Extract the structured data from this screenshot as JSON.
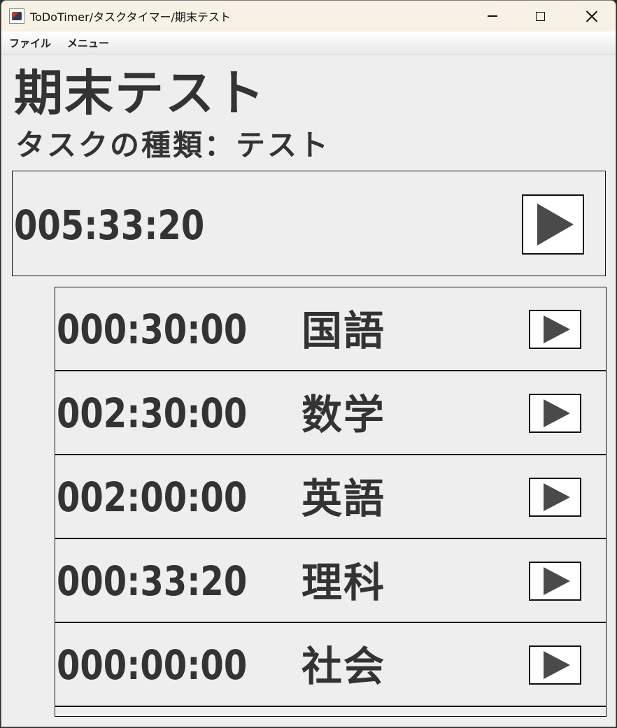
{
  "window": {
    "title": "ToDoTimer/タスクタイマー/期末テスト"
  },
  "menubar": {
    "items": [
      "ファイル",
      "メニュー"
    ]
  },
  "task": {
    "title": "期末テスト",
    "type_label": "タスクの種類：テスト",
    "total_time": "005:33:20"
  },
  "subtasks": [
    {
      "time": "000:30:00",
      "name": "国語"
    },
    {
      "time": "002:30:00",
      "name": "数学"
    },
    {
      "time": "002:00:00",
      "name": "英語"
    },
    {
      "time": "000:33:20",
      "name": "理科"
    },
    {
      "time": "000:00:00",
      "name": "社会"
    }
  ],
  "icons": {
    "play": "play-icon",
    "minimize": "minimize-icon",
    "maximize": "maximize-icon",
    "close": "close-icon",
    "app": "app-icon"
  }
}
